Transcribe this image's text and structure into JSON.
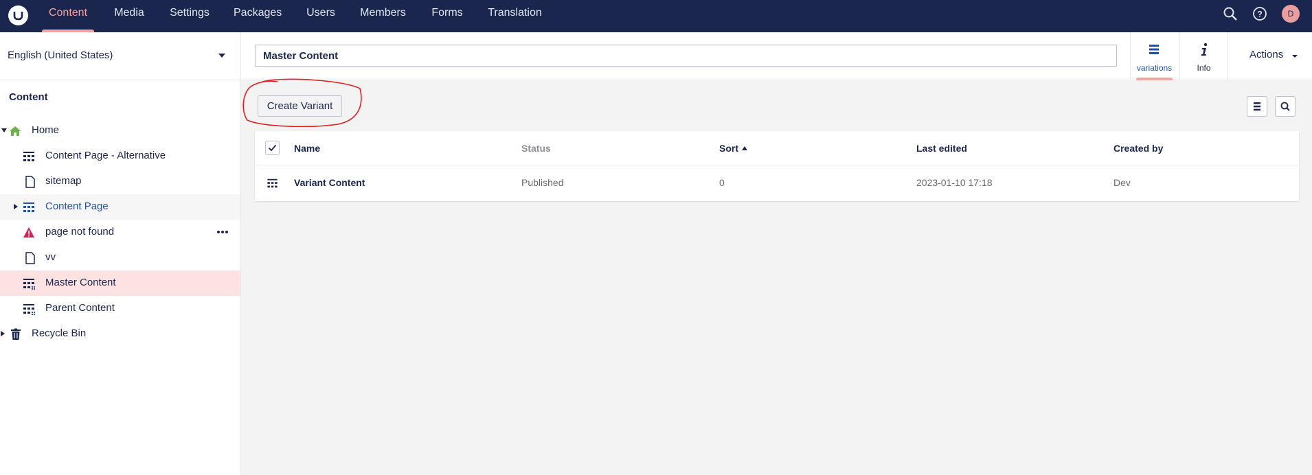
{
  "nav": {
    "items": [
      "Content",
      "Media",
      "Settings",
      "Packages",
      "Users",
      "Members",
      "Forms",
      "Translation"
    ],
    "active": "Content",
    "avatar_initial": "D"
  },
  "sidebar": {
    "language": "English (United States)",
    "tree_title": "Content",
    "nodes": [
      {
        "label": "Home",
        "icon": "home-icon"
      },
      {
        "label": "Content Page - Alternative",
        "icon": "grid-doc-icon"
      },
      {
        "label": "sitemap",
        "icon": "document-icon"
      },
      {
        "label": "Content Page",
        "icon": "grid-doc-icon"
      },
      {
        "label": "page not found",
        "icon": "warning-icon"
      },
      {
        "label": "vv",
        "icon": "document-icon"
      },
      {
        "label": "Master Content",
        "icon": "grid-doc-icon"
      },
      {
        "label": "Parent Content",
        "icon": "grid-doc-icon"
      },
      {
        "label": "Recycle Bin",
        "icon": "trash-icon"
      }
    ]
  },
  "editor": {
    "name_value": "Master Content",
    "apps": [
      {
        "label": "variations",
        "icon": "list-icon"
      },
      {
        "label": "Info",
        "icon": "info-icon"
      }
    ],
    "actions_label": "Actions",
    "create_variant_label": "Create Variant"
  },
  "table": {
    "columns": [
      "Name",
      "Status",
      "Sort",
      "Last edited",
      "Created by"
    ],
    "rows": [
      {
        "name": "Variant Content",
        "status": "Published",
        "sort": "0",
        "last_edited": "2023-01-10 17:18",
        "created_by": "Dev"
      }
    ]
  },
  "colors": {
    "header_bg": "#1b264f",
    "active_nav": "#f5a5a0",
    "selected_row": "#fde2e2",
    "annotation": "#e02020"
  }
}
